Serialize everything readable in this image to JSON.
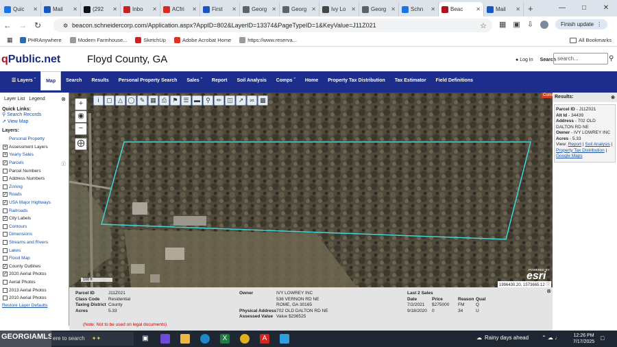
{
  "browser": {
    "tabs": [
      {
        "label": "Quic",
        "color": "#1a73e8"
      },
      {
        "label": "Mail",
        "color": "#1a55c4"
      },
      {
        "label": "(292",
        "color": "#111111"
      },
      {
        "label": "Inbo",
        "color": "#c5221f"
      },
      {
        "label": "ACfri",
        "color": "#d62d20"
      },
      {
        "label": "First",
        "color": "#1a55c4"
      },
      {
        "label": "Georg",
        "color": "#5f6368"
      },
      {
        "label": "Georg",
        "color": "#5f6368"
      },
      {
        "label": "Ivy Lo",
        "color": "#444444"
      },
      {
        "label": "Georg",
        "color": "#5f6368"
      },
      {
        "label": "Schn",
        "color": "#1a73e8"
      },
      {
        "label": "Beac",
        "color": "#b01020"
      },
      {
        "label": "Mail",
        "color": "#1a55c4"
      }
    ],
    "url": "beacon.schneidercorp.com/Application.aspx?AppID=802&LayerID=13374&PageTypeID=1&KeyValue=J11Z021",
    "finish_update": "Finish update",
    "bookmarks": [
      "PHRAnywhere",
      "Modern Farmhouse...",
      "SketchUp",
      "Adobe Acrobat Home",
      "https://www.reserva..."
    ],
    "all_bookmarks": "All Bookmarks"
  },
  "site": {
    "logo_q": "q",
    "logo_rest": "Public.net",
    "county": "Floyd County, GA",
    "login": "Log In",
    "search_label": "Search",
    "search_placeholder": "search...",
    "nav": [
      "Layers",
      "Map",
      "Search",
      "Results",
      "Personal Property Search",
      "Sales",
      "Report",
      "Soil Analysis",
      "Comps",
      "Home",
      "Property Tax Distribution",
      "Tax Estimator",
      "Field Definitions"
    ],
    "nav_active": "Map"
  },
  "left_panel": {
    "tab_layer_list": "Layer List",
    "tab_legend": "Legend",
    "quick_links_heading": "Quick Links:",
    "quick_links": [
      "Search Records",
      "View Map"
    ],
    "layers_heading": "Layers:",
    "layers": [
      {
        "label": "Personal Property",
        "checkbox": "none",
        "style": "link"
      },
      {
        "label": "Assessment Layers",
        "checkbox": "plus",
        "style": "plain"
      },
      {
        "label": "Yearly Sales",
        "checkbox": "plus",
        "style": "link"
      },
      {
        "label": "Parcels",
        "checkbox": "checked",
        "style": "link"
      },
      {
        "label": "Parcel Numbers",
        "checkbox": "empty",
        "style": "plain"
      },
      {
        "label": "Address Numbers",
        "checkbox": "empty",
        "style": "plain"
      },
      {
        "label": "Zoning",
        "checkbox": "empty",
        "style": "link"
      },
      {
        "label": "Roads",
        "checkbox": "checked",
        "style": "link"
      },
      {
        "label": "USA Major Highways",
        "checkbox": "checked",
        "style": "link"
      },
      {
        "label": "Railroads",
        "checkbox": "empty",
        "style": "link"
      },
      {
        "label": "City Labels",
        "checkbox": "checked",
        "style": "plain"
      },
      {
        "label": "Contours",
        "checkbox": "empty",
        "style": "link"
      },
      {
        "label": "Dimensions",
        "checkbox": "empty",
        "style": "link"
      },
      {
        "label": "Streams and Rivers",
        "checkbox": "empty",
        "style": "link"
      },
      {
        "label": "Lakes",
        "checkbox": "empty",
        "style": "link"
      },
      {
        "label": "Flood Map",
        "checkbox": "empty",
        "style": "link"
      },
      {
        "label": "County Outlines",
        "checkbox": "checked",
        "style": "plain"
      },
      {
        "label": "2020 Aerial Photos",
        "checkbox": "checked",
        "style": "plain"
      },
      {
        "label": "Aerial Photos",
        "checkbox": "empty",
        "style": "plain"
      },
      {
        "label": "2013 Aerial Photos",
        "checkbox": "empty",
        "style": "plain"
      },
      {
        "label": "2010 Aerial Photos",
        "checkbox": "empty",
        "style": "plain"
      }
    ],
    "restore_defaults": "Restore Layer Defaults"
  },
  "map": {
    "scale_label": "100 ft",
    "coords": "1996430.20, 1573665.12",
    "esri_powered": "POWERED BY",
    "esri": "esri",
    "parcel_color": "#3fd7d7",
    "comm_label": "Comm"
  },
  "results": {
    "heading": "Results:",
    "card": [
      {
        "label": "Parcel ID",
        "value": "J11Z021"
      },
      {
        "label": "Alt Id",
        "value": "34439"
      },
      {
        "label": "Address",
        "value": "702 OLD DALTON RD NE"
      },
      {
        "label": "Owner",
        "value": "IVY LOWREY INC"
      },
      {
        "label": "Acres",
        "value": "5.33"
      }
    ],
    "view_label": "View:",
    "view_links": [
      "Report",
      "Soil Analysis",
      "Property Tax Distribution",
      "Google Maps"
    ]
  },
  "info": {
    "parcel_id_label": "Parcel ID",
    "parcel_id": "J11Z021",
    "class_code_label": "Class Code",
    "class_code": "Residential",
    "taxing_district_label": "Taxing District",
    "taxing_district": "County",
    "acres_label": "Acres",
    "acres": "5.33",
    "owner_label": "Owner",
    "owner_lines": [
      "IVY LOWREY INC",
      "536 VERNON RD NE",
      "ROME, GA 30165"
    ],
    "physical_address_label": "Physical Address",
    "physical_address": "702 OLD DALTON RD NE",
    "assessed_value_label": "Assessed Value",
    "assessed_value": "Value $236525",
    "sales_heading": "Last 2 Sales",
    "sales_headers": [
      "Date",
      "Price",
      "Reason",
      "Qual"
    ],
    "sales_rows": [
      [
        "7/2/2021",
        "$275000",
        "FM",
        "Q"
      ],
      [
        "9/18/2020",
        "0",
        "34",
        "U"
      ]
    ],
    "note": "(Note: Not to be used on legal documents)"
  },
  "taskbar": {
    "gmls": "GEORGIAMLS",
    "search_text": "ere to search",
    "weather": "Rainy days ahead",
    "time": "12:26 PM",
    "date": "7/17/2025"
  }
}
